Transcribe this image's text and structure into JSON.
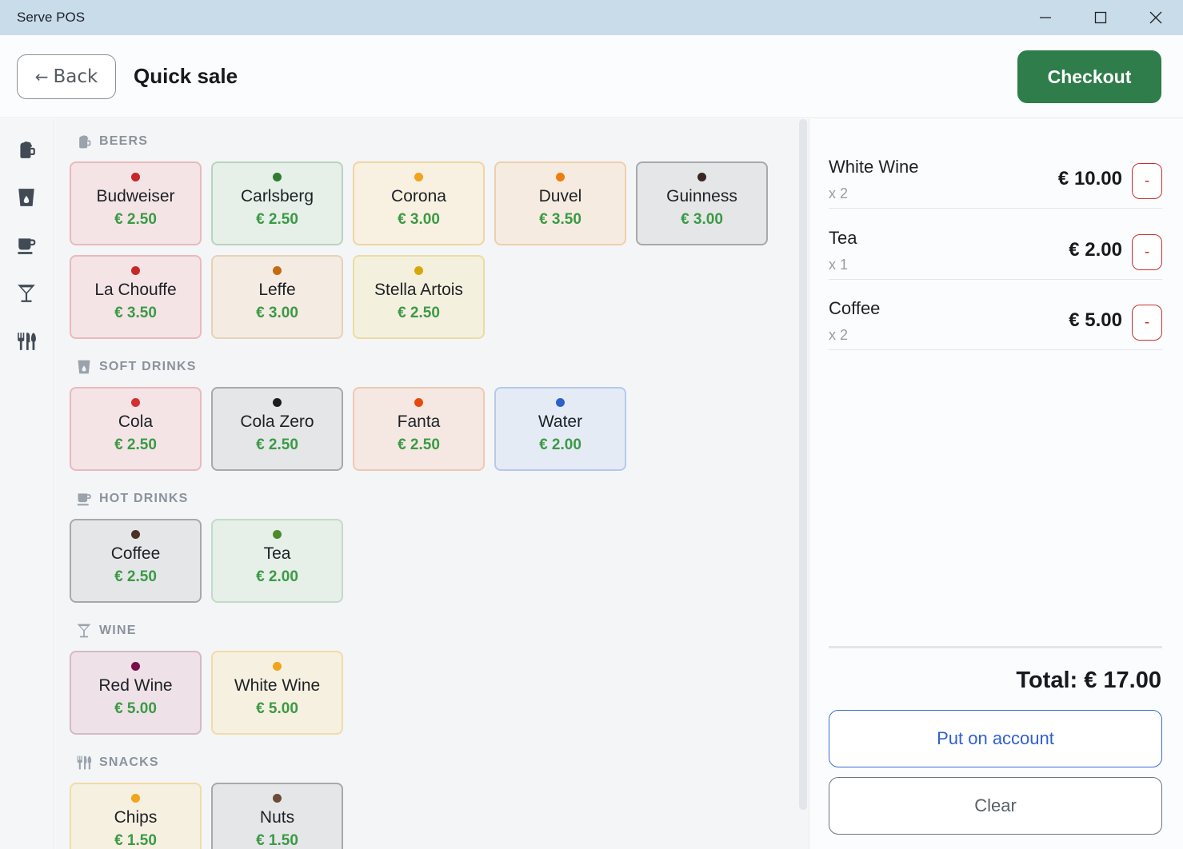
{
  "window": {
    "title": "Serve POS"
  },
  "header": {
    "back_label": "Back",
    "title": "Quick sale",
    "checkout_label": "Checkout"
  },
  "rail": [
    {
      "icon": "beer-icon"
    },
    {
      "icon": "cup-icon"
    },
    {
      "icon": "hot-drink-icon"
    },
    {
      "icon": "cocktail-icon"
    },
    {
      "icon": "utensils-icon"
    }
  ],
  "sections": [
    {
      "label": "BEERS",
      "icon": "beer-icon",
      "products": [
        {
          "name": "Budweiser",
          "price": "€ 2.50",
          "dot": "#c62828",
          "bg": "#f4e4e6",
          "border": "#eab9bd"
        },
        {
          "name": "Carlsberg",
          "price": "€ 2.50",
          "dot": "#2e7d32",
          "bg": "#e6efe8",
          "border": "#b9d4bd"
        },
        {
          "name": "Corona",
          "price": "€ 3.00",
          "dot": "#f2a41a",
          "bg": "#f8f0e0",
          "border": "#f1d5a0"
        },
        {
          "name": "Duvel",
          "price": "€ 3.50",
          "dot": "#ef7d0e",
          "bg": "#f6ebe0",
          "border": "#efcfaa"
        },
        {
          "name": "Guinness",
          "price": "€ 3.00",
          "dot": "#3a2620",
          "bg": "#e5e6e8",
          "border": "#a6a9ad"
        },
        {
          "name": "La Chouffe",
          "price": "€ 3.50",
          "dot": "#c62828",
          "bg": "#f4e4e6",
          "border": "#eab9bd"
        },
        {
          "name": "Leffe",
          "price": "€ 3.00",
          "dot": "#c36a12",
          "bg": "#f4ebe2",
          "border": "#e8d1b6"
        },
        {
          "name": "Stella Artois",
          "price": "€ 2.50",
          "dot": "#d7a80c",
          "bg": "#f4f0de",
          "border": "#ecdca0"
        }
      ]
    },
    {
      "label": "SOFT DRINKS",
      "icon": "cup-icon",
      "products": [
        {
          "name": "Cola",
          "price": "€ 2.50",
          "dot": "#d32f2f",
          "bg": "#f4e4e6",
          "border": "#eab9bd"
        },
        {
          "name": "Cola Zero",
          "price": "€ 2.50",
          "dot": "#1d1d1d",
          "bg": "#e5e6e8",
          "border": "#a6a9ad"
        },
        {
          "name": "Fanta",
          "price": "€ 2.50",
          "dot": "#e64a0e",
          "bg": "#f5e8e2",
          "border": "#efc8b4"
        },
        {
          "name": "Water",
          "price": "€ 2.00",
          "dot": "#2a62c9",
          "bg": "#e5ebf5",
          "border": "#b6c9ec"
        }
      ]
    },
    {
      "label": "HOT DRINKS",
      "icon": "hot-drink-icon",
      "products": [
        {
          "name": "Coffee",
          "price": "€ 2.50",
          "dot": "#4a3228",
          "bg": "#e5e6e8",
          "border": "#a6a9ad"
        },
        {
          "name": "Tea",
          "price": "€ 2.00",
          "dot": "#4e8a2a",
          "bg": "#e6efe8",
          "border": "#c4dac8"
        }
      ]
    },
    {
      "label": "WINE",
      "icon": "wine-glass-icon",
      "products": [
        {
          "name": "Red Wine",
          "price": "€ 5.00",
          "dot": "#7a0e4a",
          "bg": "#eee2e8",
          "border": "#d7b7c8"
        },
        {
          "name": "White Wine",
          "price": "€ 5.00",
          "dot": "#f2a41a",
          "bg": "#f6f0e0",
          "border": "#f1dca6"
        }
      ]
    },
    {
      "label": "SNACKS",
      "icon": "utensils-icon",
      "products": [
        {
          "name": "Chips",
          "price": "€ 1.50",
          "dot": "#f2a41a",
          "bg": "#f6f0e0",
          "border": "#f1dca6"
        },
        {
          "name": "Nuts",
          "price": "€ 1.50",
          "dot": "#6b4a38",
          "bg": "#e5e6e8",
          "border": "#a6a9ad"
        }
      ]
    }
  ],
  "order": {
    "lines": [
      {
        "name": "White Wine",
        "qty": "x 2",
        "amount": "€ 10.00",
        "remove_label": "-"
      },
      {
        "name": "Tea",
        "qty": "x 1",
        "amount": "€ 2.00",
        "remove_label": "-"
      },
      {
        "name": "Coffee",
        "qty": "x 2",
        "amount": "€ 5.00",
        "remove_label": "-"
      }
    ],
    "total": "Total: € 17.00",
    "account_label": "Put on account",
    "clear_label": "Clear"
  }
}
